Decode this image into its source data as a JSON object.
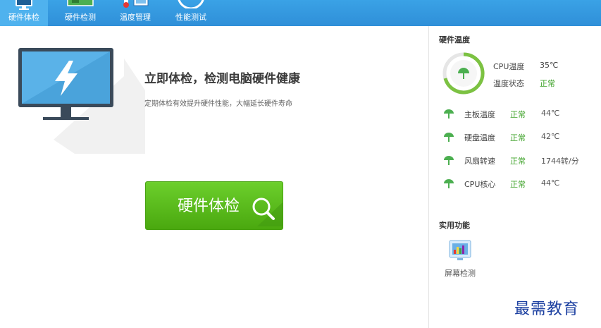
{
  "nav": {
    "tabs": [
      {
        "label": "硬件体检",
        "icon": "monitor-icon",
        "active": true
      },
      {
        "label": "硬件检测",
        "icon": "hardware-board-icon",
        "active": false
      },
      {
        "label": "温度管理",
        "icon": "thermometer-icon",
        "active": false
      },
      {
        "label": "性能测试",
        "icon": "speedometer-icon",
        "active": false
      }
    ]
  },
  "main": {
    "headline": "立即体检，检测电脑硬件健康",
    "subline": "定期体检有效提升硬件性能，大幅延长硬件寿命",
    "check_button": "硬件体检"
  },
  "temps": {
    "title": "硬件温度",
    "cpu_temp_label": "CPU温度",
    "cpu_temp_value": "35℃",
    "status_label": "温度状态",
    "status_value": "正常",
    "rows": [
      {
        "name": "主板温度",
        "status": "正常",
        "value": "44℃"
      },
      {
        "name": "硬盘温度",
        "status": "正常",
        "value": "42℃"
      },
      {
        "name": "风扇转速",
        "status": "正常",
        "value": "1744转/分"
      },
      {
        "name": "CPU核心",
        "status": "正常",
        "value": "44℃"
      }
    ]
  },
  "tools": {
    "title": "实用功能",
    "items": [
      {
        "label": "屏幕检测",
        "icon": "screen-test-icon"
      }
    ]
  },
  "watermark": "最需教育",
  "colors": {
    "nav_bg": "#2f8fd8",
    "accent_green": "#4aa80f",
    "status_green": "#3fa32a"
  }
}
